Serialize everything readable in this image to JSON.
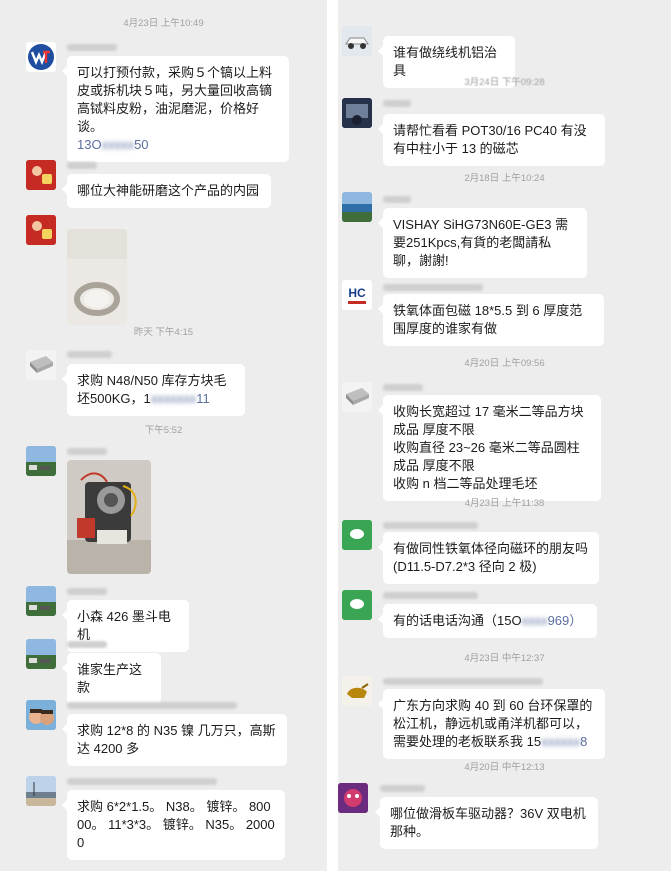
{
  "left": {
    "items": [
      {
        "kind": "time",
        "text": "4月23日 上午10:49"
      },
      {
        "kind": "msg",
        "avatar": "brand-logo",
        "text": "可以打预付款，采购５个镐以上料皮或拆机块５吨，另大量回收高镝高铽料皮粉，油泥磨泥，价格好谈。",
        "phone_visible": "13O",
        "phone_tail": "50"
      },
      {
        "kind": "msg",
        "avatar": "red-avatar",
        "text": "哪位大神能研磨这个产品的内园"
      },
      {
        "kind": "image",
        "avatar": "red-avatar",
        "desc": "ring-photo"
      },
      {
        "kind": "time",
        "text": "昨天 下午4:15"
      },
      {
        "kind": "msg",
        "avatar": "magnet-block",
        "text": "求购 N48/N50 库存方块毛坯500KG，1",
        "phone_tail": "11"
      },
      {
        "kind": "time",
        "text": "下午5:52"
      },
      {
        "kind": "image",
        "avatar": "lake-avatar",
        "desc": "motor-photo"
      },
      {
        "kind": "msg",
        "avatar": "lake-avatar",
        "text": "小森 426 墨斗电机"
      },
      {
        "kind": "msg",
        "avatar": "lake-avatar",
        "text": "谁家生产这款"
      },
      {
        "kind": "msg",
        "avatar": "kids-avatar",
        "text": "求购 12*8 的 N35 镍 几万只，高斯达 4200 多"
      },
      {
        "kind": "msg",
        "avatar": "beach-avatar",
        "text": "求购 6*2*1.5。 N38。 镀锌。 80000。 11*3*3。 镀锌。 N35。 20000"
      }
    ]
  },
  "right": {
    "items": [
      {
        "kind": "msg",
        "avatar": "car-avatar",
        "text": "谁有做绕线机铝治具"
      },
      {
        "kind": "time",
        "text": "3月24日 下午09:28"
      },
      {
        "kind": "msg",
        "avatar": "dark-avatar",
        "text": "请帮忙看看 POT30/16  PC40 有没有中柱小于 13 的磁芯"
      },
      {
        "kind": "time",
        "text": "2月18日 上午10:24"
      },
      {
        "kind": "msg",
        "avatar": "lake-avatar",
        "text": "VISHAY SiHG73N60E-GE3 需要251Kpcs,有貨的老闆請私聊，謝謝!"
      },
      {
        "kind": "msg",
        "avatar": "hc-logo",
        "text": "铁氧体面包磁 18*5.5 到 6 厚度范围厚度的谁家有做"
      },
      {
        "kind": "time",
        "text": "4月20日 上午09:56"
      },
      {
        "kind": "msg",
        "avatar": "magnet-block",
        "lines": [
          "收购长宽超过 17 毫米二等品方块成品 厚度不限",
          "收购直径 23~26 毫米二等品圆柱成品  厚度不限",
          "收购 n 档二等品处理毛坯"
        ]
      },
      {
        "kind": "time",
        "text": "4月23日 上午11:38"
      },
      {
        "kind": "msg",
        "avatar": "green-avatar",
        "text": "有做同性铁氧体径向磁环的朋友吗(D11.5-D7.2*3 径向 2 极)"
      },
      {
        "kind": "msg",
        "avatar": "green-avatar",
        "text": "有的话电话沟通（15O",
        "phone_tail": "969）"
      },
      {
        "kind": "time",
        "text": "4月23日 中午12:37"
      },
      {
        "kind": "msg",
        "avatar": "bull-avatar",
        "text": "广东方向求购 40 到 60 台环保罩的松江机，静远机或甬洋机都可以，需要处理的老板联系我 15",
        "phone_tail": "8"
      },
      {
        "kind": "time",
        "text": "4月20日 中午12:13"
      },
      {
        "kind": "msg",
        "avatar": "purple-avatar",
        "text": "哪位做滑板车驱动器？36V 双电机那种。"
      }
    ]
  }
}
